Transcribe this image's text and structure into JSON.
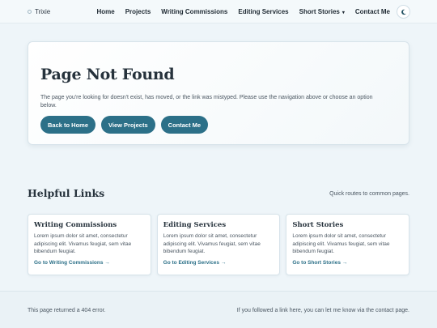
{
  "header": {
    "brand": "Trixie",
    "nav": [
      {
        "label": "Home"
      },
      {
        "label": "Projects"
      },
      {
        "label": "Writing Commissions"
      },
      {
        "label": "Editing Services"
      },
      {
        "label": "Short Stories",
        "caret": "▾"
      },
      {
        "label": "Contact Me"
      }
    ],
    "theme_icon": "moon-icon"
  },
  "hero": {
    "title": "Page Not Found",
    "message": "The page you're looking for doesn't exist, has moved, or the link was mistyped. Please use the navigation above or choose an option below.",
    "buttons": [
      {
        "label": "Back to Home"
      },
      {
        "label": "View Projects"
      },
      {
        "label": "Contact Me"
      }
    ]
  },
  "helpful": {
    "title": "Helpful Links",
    "subtitle": "Quick routes to common pages.",
    "cards": [
      {
        "title": "Writing Commissions",
        "desc": "Lorem ipsum dolor sit amet, consectetur adipiscing elit. Vivamus feugiat, sem vitae bibendum feugiat.",
        "link": "Go to Writing Commissions →"
      },
      {
        "title": "Editing Services",
        "desc": "Lorem ipsum dolor sit amet, consectetur adipiscing elit. Vivamus feugiat, sem vitae bibendum feugiat.",
        "link": "Go to Editing Services →"
      },
      {
        "title": "Short Stories",
        "desc": "Lorem ipsum dolor sit amet, consectetur adipiscing elit. Vivamus feugiat, sem vitae bibendum feugiat.",
        "link": "Go to Short Stories →"
      }
    ]
  },
  "footer": {
    "left": "This page returned a 404 error.",
    "right": "If you followed a link here, you can let me know via the contact page."
  },
  "colors": {
    "accent": "#2c7088",
    "background": "#eef5f9"
  }
}
